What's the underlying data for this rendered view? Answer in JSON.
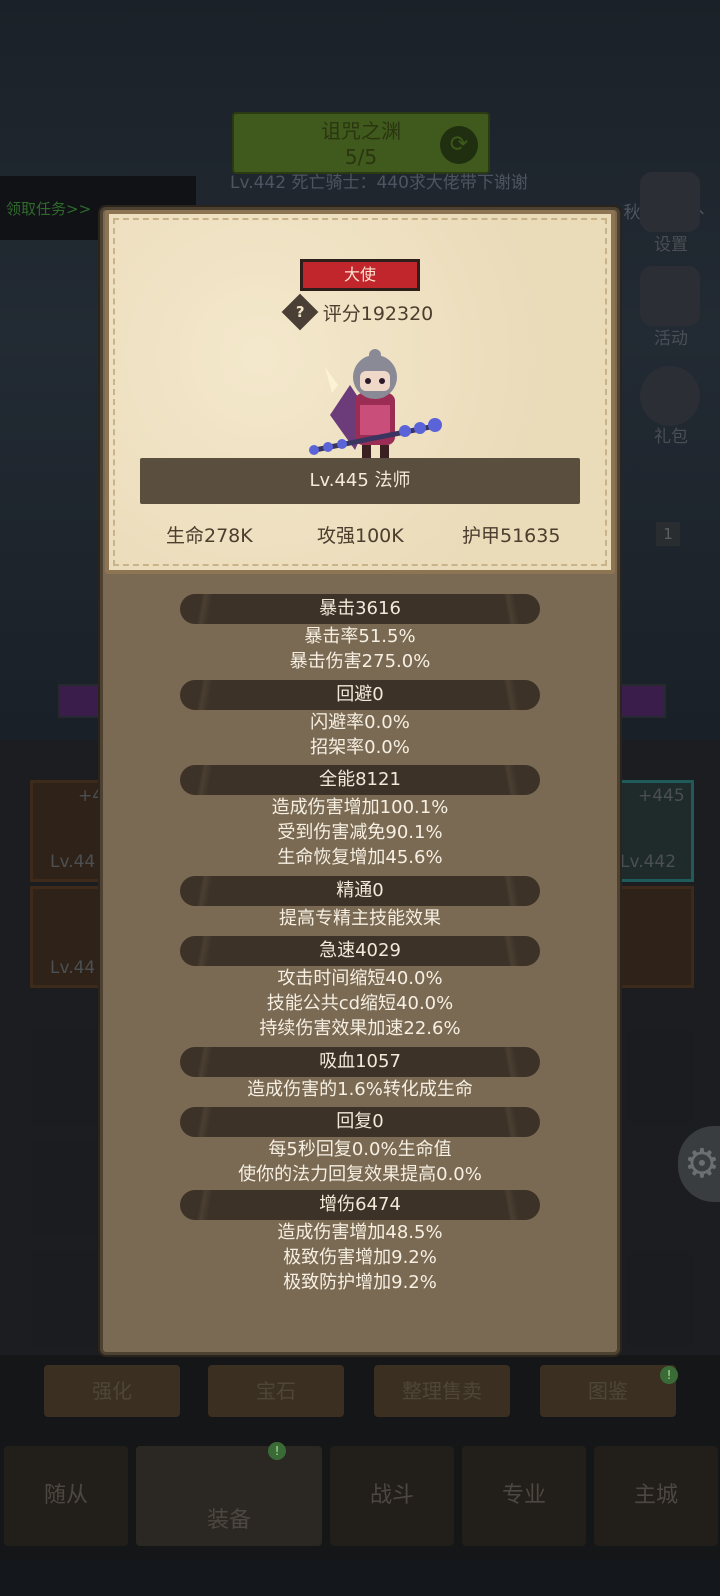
{
  "background": {
    "dungeon_title": "诅咒之渊",
    "dungeon_progress": "5/5",
    "chat_line_1": "Lv.442 死亡骑士：440求大佬带下谢谢",
    "chat_line_2": "Lv.445 秋豆麻袋丶",
    "quest_label": "领取任务>>",
    "side_settings": "设置",
    "side_activity": "活动",
    "side_gift": "礼包",
    "side_counter": "1",
    "eq_top_left_plus": "+4",
    "eq_top_left_lv": "Lv.44",
    "eq_top_right_plus": "+445",
    "eq_top_right_lv": "Lv.442",
    "eq_bottom_left_lv": "Lv.44",
    "tool_buttons": [
      "强化",
      "宝石",
      "整理售卖",
      "图鉴"
    ],
    "nav_buttons": [
      "随从",
      "装备",
      "战斗",
      "专业",
      "主城"
    ]
  },
  "card": {
    "title_badge": "大使",
    "score_label": "评分192320",
    "level_class": "Lv.445 法师",
    "hp": "生命278K",
    "attack": "攻强100K",
    "armor": "护甲51635"
  },
  "sections": [
    {
      "title": "暴击3616",
      "lines": [
        "暴击率51.5%",
        "暴击伤害275.0%"
      ]
    },
    {
      "title": "回避0",
      "lines": [
        "闪避率0.0%",
        "招架率0.0%"
      ]
    },
    {
      "title": "全能8121",
      "lines": [
        "造成伤害增加100.1%",
        "受到伤害减免90.1%",
        "生命恢复增加45.6%"
      ]
    },
    {
      "title": "精通0",
      "lines": [
        "提高专精主技能效果"
      ]
    },
    {
      "title": "急速4029",
      "lines": [
        "攻击时间缩短40.0%",
        "技能公共cd缩短40.0%",
        "持续伤害效果加速22.6%"
      ]
    },
    {
      "title": "吸血1057",
      "lines": [
        "造成伤害的1.6%转化成生命"
      ]
    },
    {
      "title": "回复0",
      "lines": [
        "每5秒回复0.0%生命值",
        "使你的法力回复效果提高0.0%"
      ]
    },
    {
      "title": "增伤6474",
      "lines": [
        "造成伤害增加48.5%",
        "极致伤害增加9.2%",
        "极致防护增加9.2%"
      ]
    }
  ],
  "colors": {
    "panel": "#7a6a53",
    "card": "#efe0c0",
    "badge_red": "#c0262b",
    "section_header": "#3d3227"
  }
}
